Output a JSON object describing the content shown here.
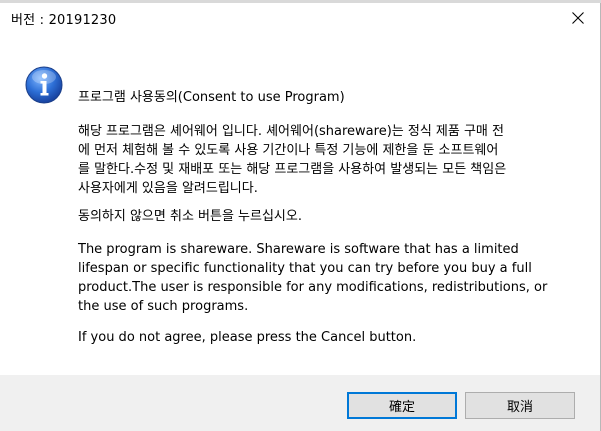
{
  "window": {
    "title": "버전 : 20191230",
    "close_icon": "close-icon"
  },
  "dialog": {
    "icon": "info-icon",
    "heading": "프로그램 사용동의(Consent to use Program)",
    "korean_notice": "해당 프로그램은 셰어웨어 입니다. 셰어웨어(shareware)는 정식 제품 구매 전에 먼저 체험해 볼 수 있도록 사용 기간이나 특정 기능에 제한을 둔 소프트웨어를 말한다.수정 및 재배포 또는 해당 프로그램을 사용하여 발생되는 모든 책임은 사용자에게 있음을 알려드립니다.",
    "korean_cancel_prompt": "동의하지 않으면 취소 버튼을 누르십시오.",
    "english_notice": "The program is shareware. Shareware is software that has a limited lifespan or specific functionality that you can try before you buy a full product.The user is responsible for any modifications, redistributions, or the use of such programs.",
    "english_cancel_prompt": "If you do not agree, please press the Cancel button."
  },
  "buttons": {
    "ok_label": "確定",
    "cancel_label": "取消"
  }
}
